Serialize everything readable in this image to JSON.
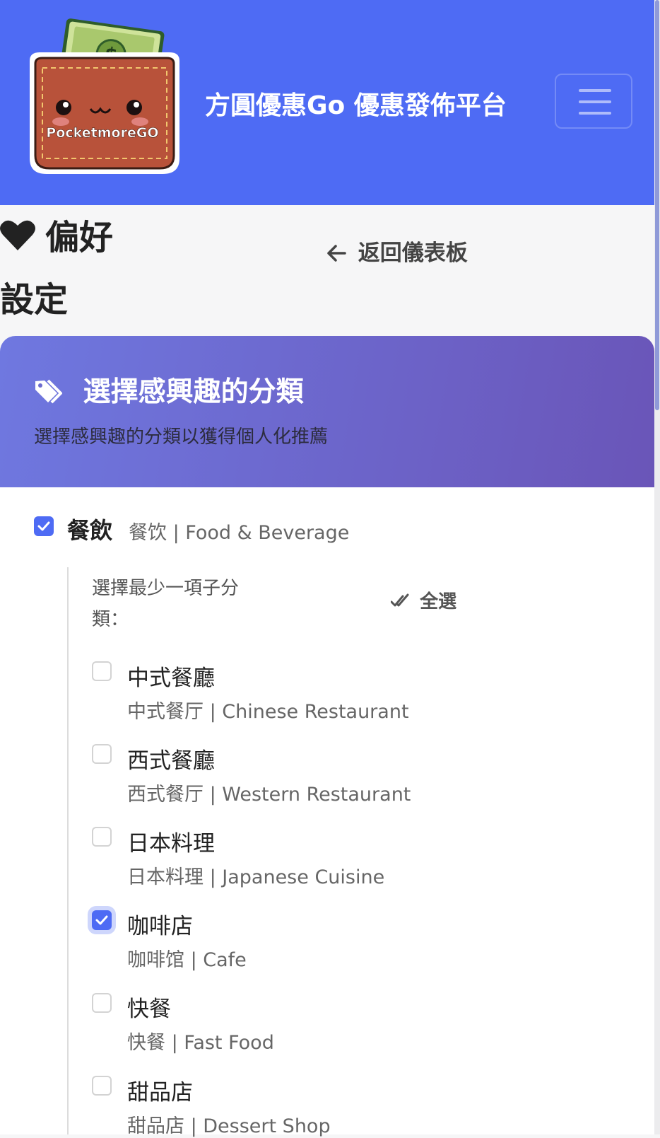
{
  "navbar": {
    "logo_text": "PocketmoreGO",
    "brand": "方圓優惠Go 優惠發佈平台",
    "menu_icon": "hamburger-icon",
    "color": "#4e6bf4"
  },
  "page": {
    "title_icon": "heart-icon",
    "title_line1": "偏好",
    "title_line2": "設定",
    "back_icon": "arrow-left-icon",
    "back_label": "返回儀表板"
  },
  "card": {
    "title_icon": "tags-icon",
    "title": "選擇感興趣的分類",
    "subtitle": "選擇感興趣的分類以獲得個人化推薦"
  },
  "category": {
    "checked": true,
    "name": "餐飲",
    "desc": "餐饮 | Food & Beverage",
    "hint": "選擇最少一項子分類：",
    "select_all_icon": "double-check-icon",
    "select_all_label": "全選",
    "subcategories": [
      {
        "name": "中式餐廳",
        "desc": "中式餐厅 | Chinese Restaurant",
        "checked": false
      },
      {
        "name": "西式餐廳",
        "desc": "西式餐厅 | Western Restaurant",
        "checked": false
      },
      {
        "name": "日本料理",
        "desc": "日本料理 | Japanese Cuisine",
        "checked": false
      },
      {
        "name": "咖啡店",
        "desc": "咖啡馆 | Cafe",
        "checked": true
      },
      {
        "name": "快餐",
        "desc": "快餐 | Fast Food",
        "checked": false
      },
      {
        "name": "甜品店",
        "desc": "甜品店 | Dessert Shop",
        "checked": false
      }
    ]
  }
}
